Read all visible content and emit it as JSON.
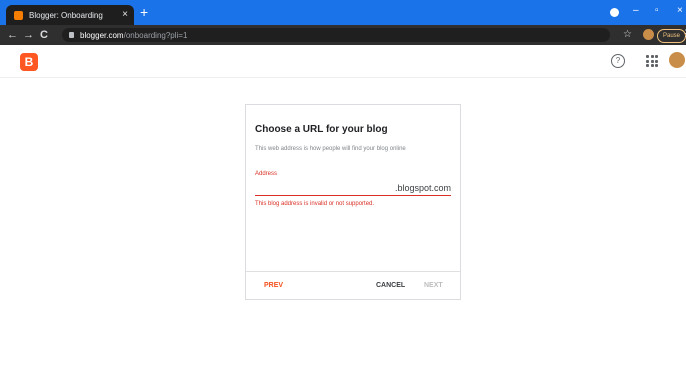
{
  "browser": {
    "tab_title": "Blogger: Onboarding",
    "tab_close": "×",
    "new_tab": "+",
    "url_host": "blogger.com",
    "url_path": "/onboarding?pli=1",
    "nav": {
      "back": "←",
      "forward": "→",
      "reload": "C"
    },
    "window": {
      "minimize": "–",
      "maximize": "▫",
      "close": "×"
    },
    "star": "☆",
    "profile_label": "Pause",
    "menu": "⋮"
  },
  "appbar": {
    "logo_letter": "B",
    "help": "?"
  },
  "dialog": {
    "title": "Choose a URL for your blog",
    "description": "This web address is how people will find your blog online",
    "address_label": "Address",
    "address_value": "",
    "address_suffix": ".blogspot.com",
    "error": "This blog address is invalid or not supported.",
    "prev": "PREV",
    "cancel": "CANCEL",
    "next": "NEXT"
  },
  "colors": {
    "brand": "#ff5722",
    "error": "#d93025",
    "chrome_tabbar": "#1a73e8"
  }
}
